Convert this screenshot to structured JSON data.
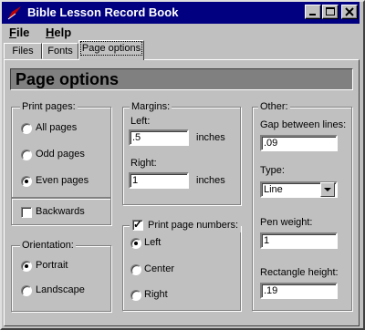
{
  "window": {
    "title": "Bible Lesson Record Book"
  },
  "menu": [
    "File",
    "Help"
  ],
  "tabs": [
    "Files",
    "Fonts",
    "Page options"
  ],
  "active_tab": "Page options",
  "page_header": "Page options",
  "print_pages": {
    "label": "Print pages:",
    "options": [
      "All pages",
      "Odd pages",
      "Even pages"
    ],
    "selected": "Even pages",
    "backwards": {
      "label": "Backwards",
      "checked": false
    }
  },
  "orientation": {
    "label": "Orientation:",
    "options": [
      "Portrait",
      "Landscape"
    ],
    "selected": "Portrait"
  },
  "margins": {
    "label": "Margins:",
    "left_label": "Left:",
    "left_value": ".5",
    "left_unit": "inches",
    "right_label": "Right:",
    "right_value": "1",
    "right_unit": "inches"
  },
  "page_numbers": {
    "label": "Print page numbers:",
    "checked": true,
    "options": [
      "Left",
      "Center",
      "Right"
    ],
    "selected": "Left"
  },
  "other": {
    "label": "Other:",
    "gap_label": "Gap between lines:",
    "gap_value": ".09",
    "type_label": "Type:",
    "type_value": "Line",
    "pen_label": "Pen weight:",
    "pen_value": "1",
    "rect_label": "Rectangle height:",
    "rect_value": ".19"
  },
  "icons": {
    "app": "quill-icon",
    "minimize": "minimize-icon",
    "maximize": "maximize-icon",
    "close": "close-icon",
    "dropdown": "chevron-down-icon"
  },
  "colors": {
    "titlebar": "#000080",
    "face": "#c0c0c0",
    "header": "#808080"
  }
}
